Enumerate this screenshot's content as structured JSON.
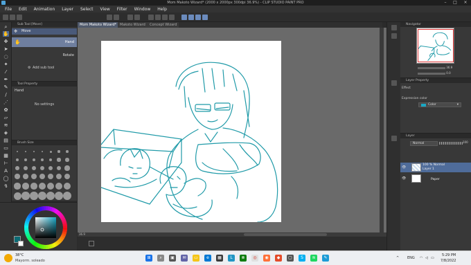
{
  "window": {
    "title": "Mom Makoto Wizard* (2000 x 2000px 300dpi 36.9%) - CLIP STUDIO PAINT PRO",
    "controls": [
      "minimize-icon",
      "maximize-icon",
      "close-icon"
    ]
  },
  "menu": [
    "File",
    "Edit",
    "Animation",
    "Layer",
    "Select",
    "View",
    "Filter",
    "Window",
    "Help"
  ],
  "doc_tabs": [
    "Mom Makoto Wizard*",
    "Makoto Wizard",
    "Concept Wizard"
  ],
  "subtool_panel": {
    "title": "Sub Tool [Move]",
    "group": "Move",
    "items": [
      "Hand",
      "Rotate"
    ],
    "add_label": "Add sub tool"
  },
  "tool_property": {
    "title": "Tool Property",
    "tool_name": "Hand",
    "empty_text": "No settings"
  },
  "brush_size": {
    "title": "Brush Size"
  },
  "canvas": {
    "zoom": "36.9"
  },
  "navigator": {
    "title": "Navigator",
    "zoom_value": "36.9",
    "rotation_value": "0.0"
  },
  "layer_property": {
    "title": "Layer Property",
    "effect_label": "Effect",
    "expression_label": "Expression color",
    "expression_value": "Color"
  },
  "layer_panel": {
    "title": "Layer",
    "blend_mode": "Normal",
    "opacity": "100",
    "layers": [
      {
        "mode": "100 % Normal",
        "name": "Layer 1"
      },
      {
        "mode": "",
        "name": "Paper"
      }
    ]
  },
  "taskbar": {
    "temperature": "38°C",
    "weather": "Mayorm. soleado",
    "language": "ENG",
    "time": "5:29 PM",
    "date": "7/8/2022"
  },
  "colors": {
    "sketch": "#1f9aa8",
    "selection": "#4f6c9a",
    "panel": "#383838"
  }
}
